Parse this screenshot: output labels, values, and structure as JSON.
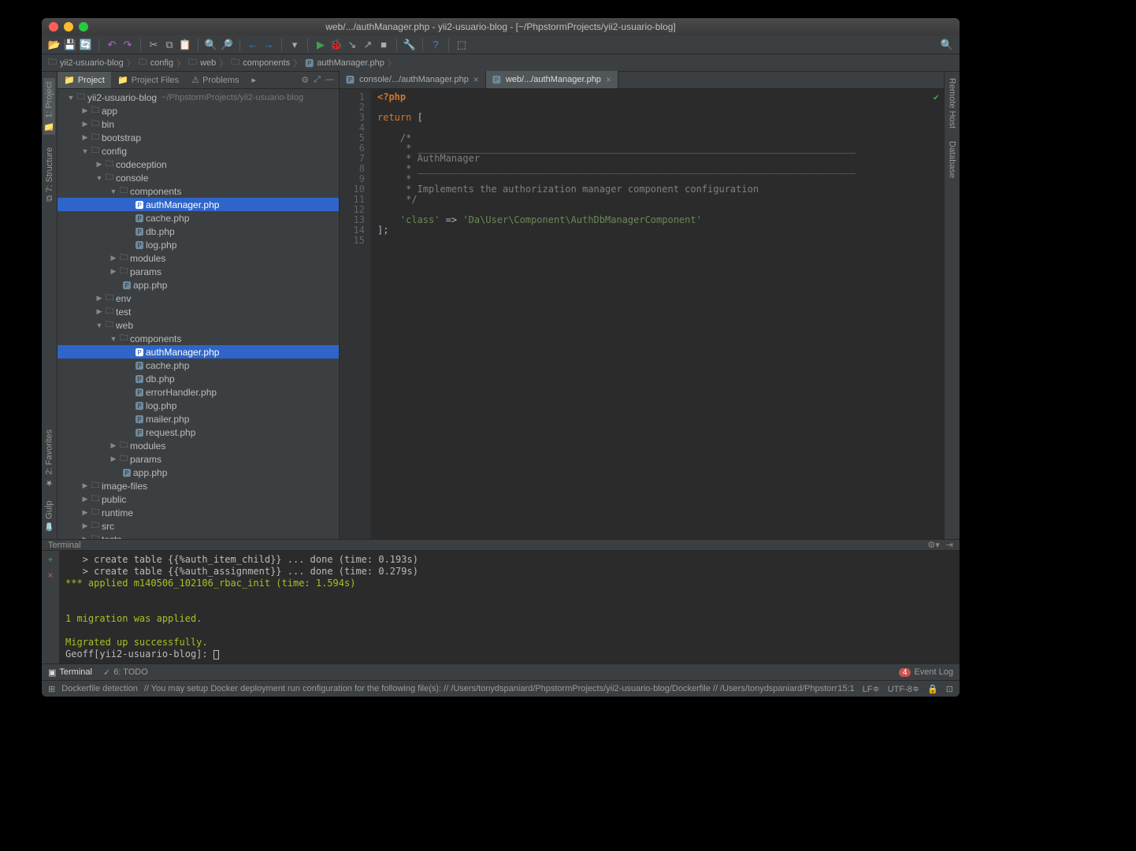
{
  "title": "web/.../authManager.php - yii2-usuario-blog - [~/PhpstormProjects/yii2-usuario-blog]",
  "breadcrumb": [
    "yii2-usuario-blog",
    "config",
    "web",
    "components",
    "authManager.php"
  ],
  "sidebarTabs": {
    "project": "Project",
    "projectFiles": "Project Files",
    "problems": "Problems"
  },
  "leftTools": {
    "project": "1: Project",
    "structure": "7: Structure"
  },
  "leftToolsBottom": {
    "favorites": "2: Favorites",
    "gulp": "Gulp"
  },
  "rightTools": {
    "remoteHost": "Remote Host",
    "database": "Database"
  },
  "tree": {
    "root": {
      "name": "yii2-usuario-blog",
      "meta": "~/PhpstormProjects/yii2-usuario-blog"
    },
    "app": "app",
    "bin": "bin",
    "bootstrap": "bootstrap",
    "config": "config",
    "codeception": "codeception",
    "console": "console",
    "components": "components",
    "authManager": "authManager.php",
    "cache": "cache.php",
    "db": "db.php",
    "log": "log.php",
    "modules": "modules",
    "params": "params",
    "appphp": "app.php",
    "env": "env",
    "test": "test",
    "web": "web",
    "errorHandler": "errorHandler.php",
    "mailer": "mailer.php",
    "request": "request.php",
    "imagefiles": "image-files",
    "public": "public",
    "runtime": "runtime",
    "src": "src",
    "tests": "tests"
  },
  "editorTabs": {
    "t1": "console/.../authManager.php",
    "t2": "web/.../authManager.php"
  },
  "code": {
    "l1": "<?php",
    "l2": "",
    "l3a": "return",
    "l3b": " [",
    "l5": "/*",
    "l6": " * _____________________________________________________________________________",
    "l7": " * AuthManager",
    "l8": " * _____________________________________________________________________________",
    "l9": " *",
    "l10": " * Implements the authorization manager component configuration",
    "l11": " */",
    "l13a": "'class'",
    "l13b": " => ",
    "l13c": "'Da\\User\\Component\\AuthDbManagerComponent'",
    "l14": "];"
  },
  "terminal": {
    "title": "Terminal",
    "l1": "   > create table {{%auth_item_child}} ... done (time: 0.193s)",
    "l2": "   > create table {{%auth_assignment}} ... done (time: 0.279s)",
    "l3": "*** applied m140506_102106_rbac_init (time: 1.594s)",
    "l4": "1 migration was applied.",
    "l5": "Migrated up successfully.",
    "prompt": "Geoff[yii2-usuario-blog]:"
  },
  "bottomTabs": {
    "terminal": "Terminal",
    "todo": "6: TODO",
    "eventLog": "Event Log",
    "badge": "4"
  },
  "status": {
    "left1": "Dockerfile detection",
    "left2": "// You may setup Docker deployment run configuration for the following file(s): // /Users/tonydspaniard/PhpstormProjects/yii2-usuario-blog/Dockerfile // /Users/tonydspaniard/PhpstormProjects/y…",
    "pos": "15:1",
    "lf": "LF≑",
    "enc": "UTF-8≑"
  }
}
